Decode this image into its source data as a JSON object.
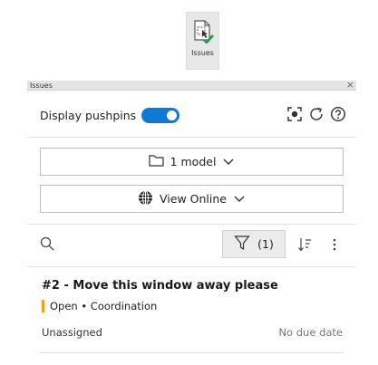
{
  "ribbon": {
    "issues_label": "Issues"
  },
  "palette": {
    "title": "Issues",
    "close": "×",
    "display_pushpins_label": "Display pushpins",
    "display_pushpins_on": true,
    "model_selector": "1 model",
    "view_selector": "View Online",
    "filter_count": "(1)",
    "accent_color": "#0f7ad6",
    "status_color": "#f0a11a"
  },
  "issue": {
    "title": "#2 - Move this window away please",
    "status": "Open • Coordination",
    "assignee": "Unassigned",
    "due": "No due date"
  }
}
